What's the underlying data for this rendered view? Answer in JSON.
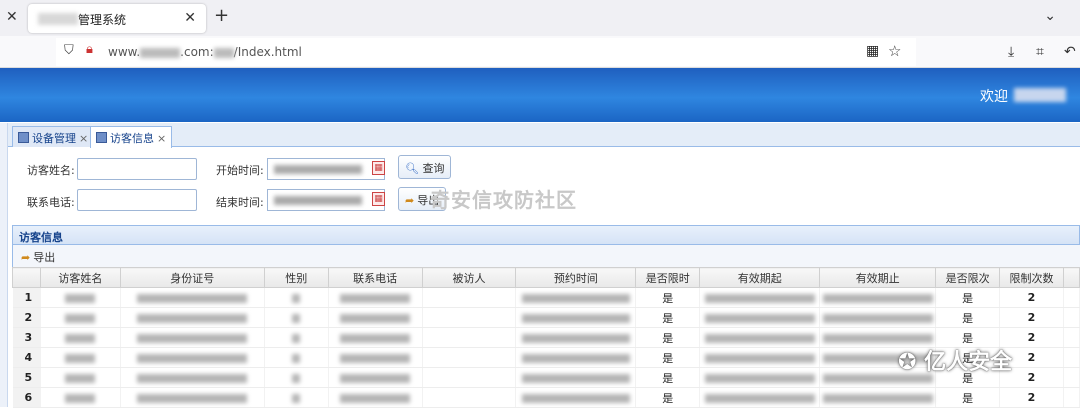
{
  "browser": {
    "tab_title": "管理系统",
    "url_prefix": "www.",
    "url_mid": ".com:",
    "url_suffix": "/Index.html"
  },
  "header": {
    "welcome": "欢迎"
  },
  "app_tabs": [
    {
      "label": "设备管理"
    },
    {
      "label": "访客信息"
    }
  ],
  "search": {
    "name_label": "访客姓名:",
    "phone_label": "联系电话:",
    "start_label": "开始时间:",
    "end_label": "结束时间:",
    "query_button": "查询",
    "export_button": "导出"
  },
  "watermark": "奇安信攻防社区",
  "grid": {
    "title": "访客信息",
    "toolbar_export": "导出",
    "columns": [
      "访客姓名",
      "身份证号",
      "性别",
      "联系电话",
      "被访人",
      "预约时间",
      "是否限时",
      "有效期起",
      "有效期止",
      "是否限次",
      "限制次数"
    ],
    "rows": [
      {
        "n": "1",
        "limited_time": "是",
        "limited_count": "是",
        "count": "2"
      },
      {
        "n": "2",
        "limited_time": "是",
        "limited_count": "是",
        "count": "2"
      },
      {
        "n": "3",
        "limited_time": "是",
        "limited_count": "是",
        "count": "2"
      },
      {
        "n": "4",
        "limited_time": "是",
        "limited_count": "是",
        "count": "2"
      },
      {
        "n": "5",
        "limited_time": "是",
        "limited_count": "是",
        "count": "2"
      },
      {
        "n": "6",
        "limited_time": "是",
        "limited_count": "是",
        "count": "2"
      }
    ]
  },
  "wechat_watermark": "亿人安全"
}
